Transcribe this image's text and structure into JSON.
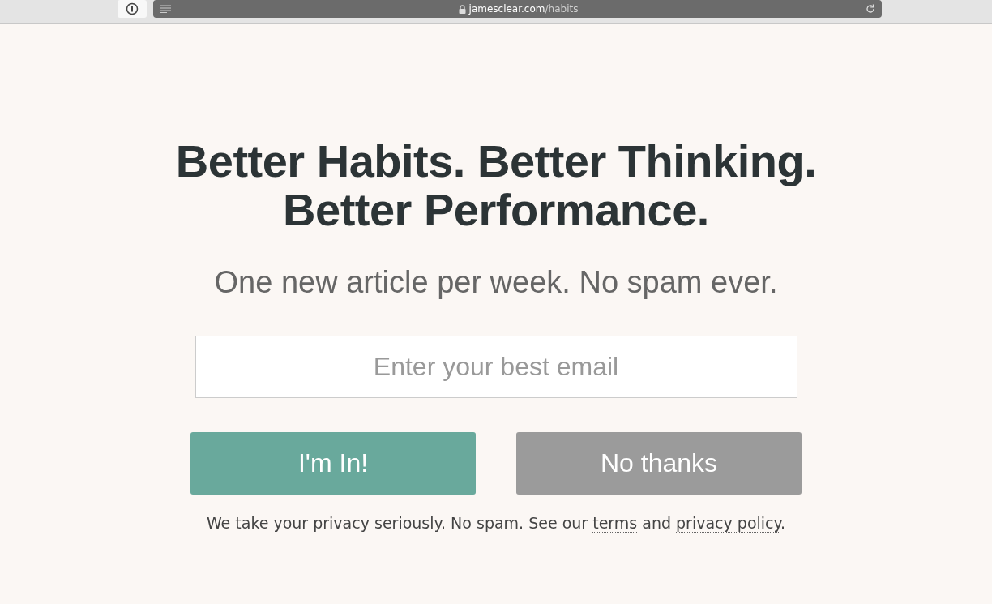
{
  "browser": {
    "domain": "jamesclear.com",
    "path": "/habits"
  },
  "headline": [
    "Better Habits. Better Thinking.",
    "Better Performance."
  ],
  "subtitle": "One new article per week. No spam ever.",
  "email_field": {
    "placeholder": "Enter your best email"
  },
  "buttons": [
    {
      "label": "I'm In!",
      "kind": "primary"
    },
    {
      "label": "No thanks",
      "kind": "secondary"
    }
  ],
  "privacy_note": {
    "before": "We take your privacy seriously. No spam. See our",
    "link_1": "terms",
    "middle": "and",
    "link_2": "privacy policy",
    "after": "."
  }
}
